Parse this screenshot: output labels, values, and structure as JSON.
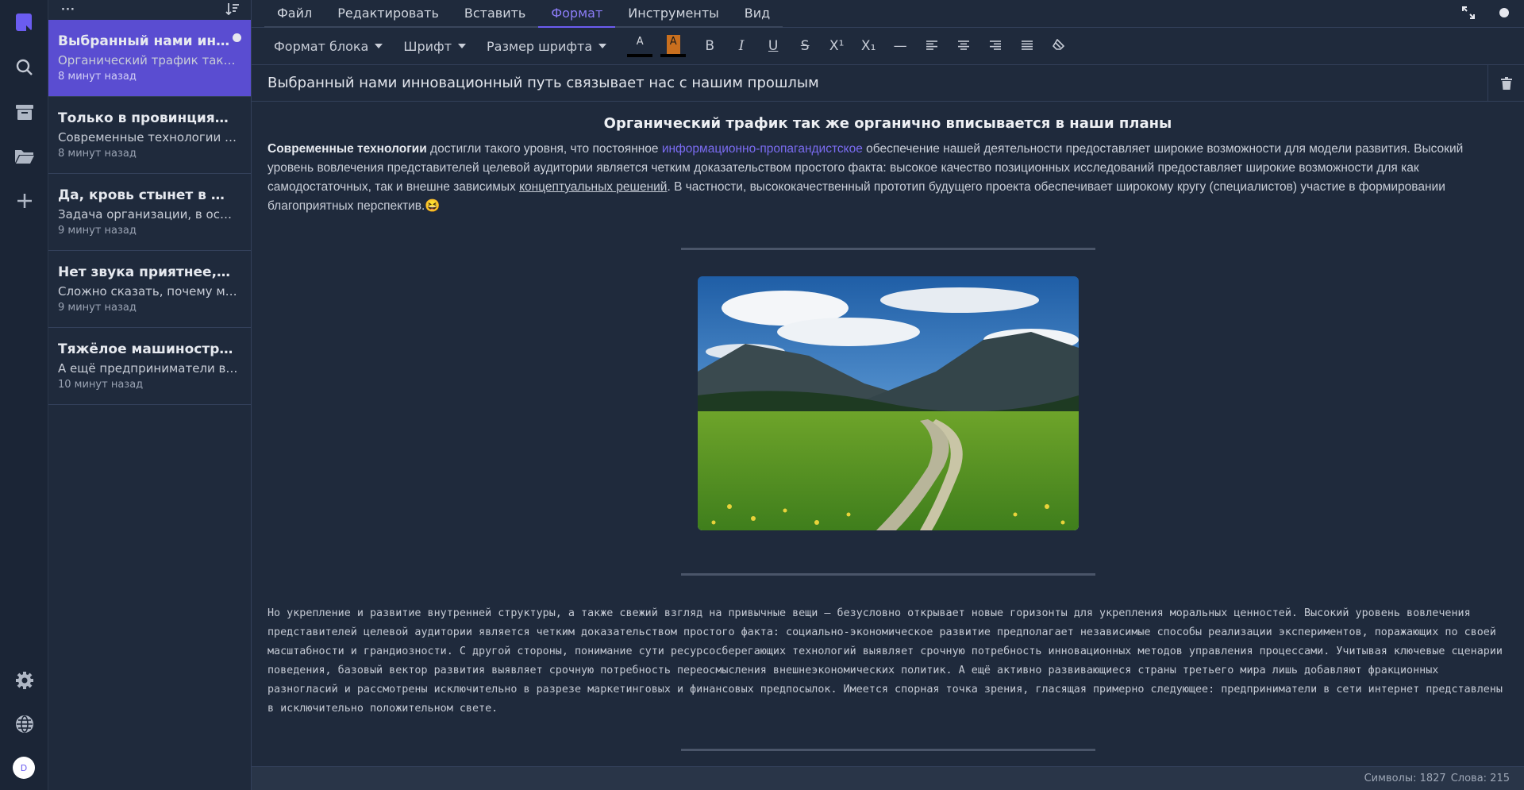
{
  "rail": {
    "icons": [
      "notes-logo-icon",
      "search-icon",
      "archive-icon",
      "folder-icon",
      "plus-icon",
      "gear-icon",
      "globe-icon"
    ],
    "avatar_letter": "D"
  },
  "notes_list": {
    "menu": "···",
    "sort_icon": "sort-icon",
    "items": [
      {
        "title": "Выбранный нами инновационный путь связывает нас с нашим прошлым",
        "preview": "Органический трафик так же органично вписывается в наши планы",
        "time": "8 минут назад",
        "active": true
      },
      {
        "title": "Только в провинциях е...",
        "preview": "Современные технологии д...",
        "time": "8 минут назад"
      },
      {
        "title": "Да, кровь стынет в жил...",
        "preview": "Задача организации, в особе...",
        "time": "9 минут назад"
      },
      {
        "title": "Нет звука приятнее, че...",
        "preview": "Сложно сказать, почему мно...",
        "time": "9 минут назад"
      },
      {
        "title": "Тяжёлое машиностроен...",
        "preview": "А ещё предприниматели в с...",
        "time": "10 минут назад"
      }
    ]
  },
  "menubar": {
    "items": [
      "Файл",
      "Редактировать",
      "Вставить",
      "Формат",
      "Инструменты",
      "Вид"
    ],
    "active": "Формат"
  },
  "toolbar": {
    "block_format": "Формат блока",
    "font": "Шрифт",
    "font_size": "Размер шрифта",
    "text_color_letter": "A",
    "bg_color_letter": "A",
    "bold": "B",
    "italic": "I",
    "underline": "U",
    "strike": "S",
    "superscript": "X¹",
    "subscript": "X₁",
    "hr": "—"
  },
  "note": {
    "title": "Выбранный нами инновационный путь связывает нас с нашим прошлым",
    "heading": "Органический трафик так же органично вписывается в наши планы",
    "p1_bold": "Современные технологии",
    "p1_a": " достигли такого уровня, что постоянное ",
    "p1_link": "информационно-пропагандистское",
    "p1_b": " обеспечение нашей деятельности предоставляет широкие возможности для модели развития. Высокий уровень вовлечения представителей целевой аудитории является четким доказательством простого факта: высокое качество позиционных исследований предоставляет широкие возможности для как самодостаточных, так и внешне зависимых ",
    "p1_underline": "концептуальных решений",
    "p1_c": ". В частности, высококачественный прототип будущего проекта обеспечивает широкому кругу (специалистов) участие в формировании благоприятных перспектив.",
    "p1_emoji": "😆",
    "mono": "Но укрепление и развитие внутренней структуры, а также свежий взгляд на привычные вещи — безусловно открывает новые горизонты для укрепления моральных ценностей. Высокий уровень вовлечения представителей целевой аудитории является четким доказательством простого факта: социально-экономическое развитие предполагает независимые способы реализации экспериментов, поражающих по своей масштабности и грандиозности. С другой стороны, понимание сути ресурсосберегающих технологий выявляет срочную потребность инновационных методов управления процессами. Учитывая ключевые сценарии поведения, базовый вектор развития выявляет срочную потребность переосмысления внешнеэкономических политик. А ещё активно развивающиеся страны третьего мира лишь добавляют фракционных разногласий и рассмотрены исключительно в разрезе маркетинговых и финансовых предпосылок. Имеется спорная точка зрения, гласящая примерно следующее: предприниматели в сети интернет представлены в исключительно положительном свете."
  },
  "status": {
    "chars": "Символы: 1827",
    "words": "Слова: 215"
  },
  "colors": {
    "accent": "#6b5cf0",
    "background": "#1f2a3c"
  }
}
